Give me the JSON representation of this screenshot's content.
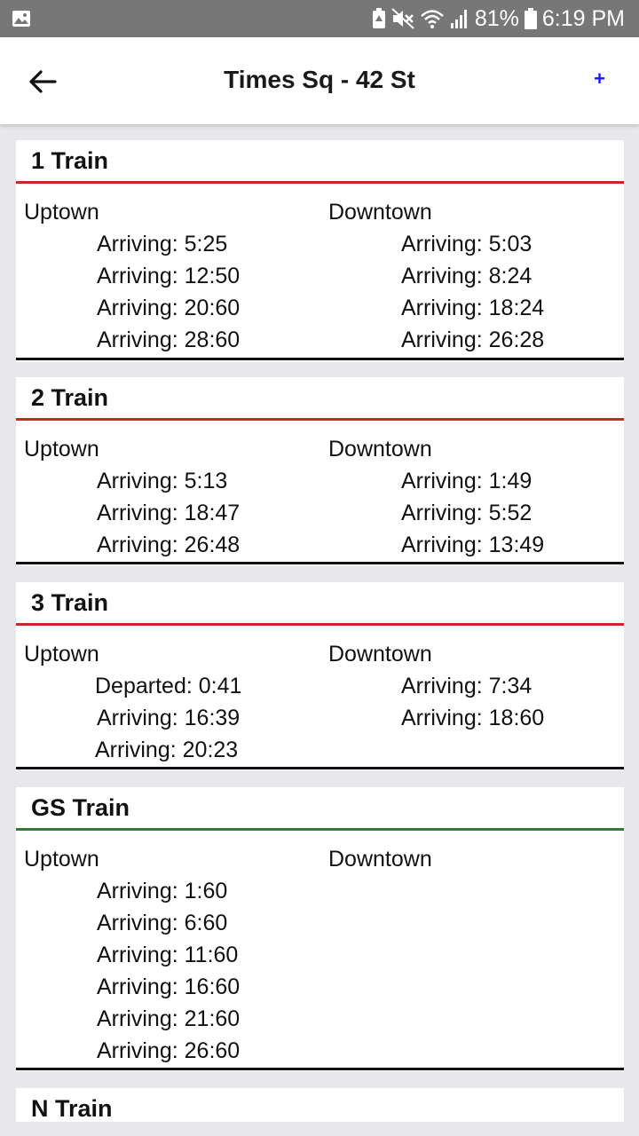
{
  "status_bar": {
    "battery_percent": "81%",
    "time": "6:19 PM",
    "icons": [
      "gallery-icon",
      "battery-saver-icon",
      "mute-icon",
      "wifi-icon",
      "signal-icon",
      "battery-icon"
    ]
  },
  "app_bar": {
    "title": "Times Sq - 42 St",
    "back_icon": "arrow-left-icon",
    "add_label": "+"
  },
  "colors": {
    "red_line": "#c62828",
    "green_line": "#2e7d32"
  },
  "trains": [
    {
      "name": "1 Train",
      "line_color": "#c62828",
      "uptown_label": "Uptown",
      "downtown_label": "Downtown",
      "uptown": [
        "Arriving: 5:25",
        "Arriving: 12:50",
        "Arriving: 20:60",
        "Arriving: 28:60"
      ],
      "downtown": [
        "Arriving: 5:03",
        "Arriving: 8:24",
        "Arriving: 18:24",
        "Arriving: 26:28"
      ]
    },
    {
      "name": "2 Train",
      "line_color": "#c62828",
      "uptown_label": "Uptown",
      "downtown_label": "Downtown",
      "uptown": [
        "Arriving: 5:13",
        "Arriving: 18:47",
        "Arriving: 26:48"
      ],
      "downtown": [
        "Arriving: 1:49",
        "Arriving: 5:52",
        "Arriving: 13:49"
      ]
    },
    {
      "name": "3 Train",
      "line_color": "#c62828",
      "uptown_label": "Uptown",
      "downtown_label": "Downtown",
      "uptown": [
        "Departed: 0:41",
        "Arriving: 16:39",
        "Arriving: 20:23"
      ],
      "downtown": [
        "Arriving: 7:34",
        "Arriving: 18:60"
      ]
    },
    {
      "name": "GS Train",
      "line_color": "#2e7d32",
      "uptown_label": "Uptown",
      "downtown_label": "Downtown",
      "uptown": [
        "Arriving: 1:60",
        "Arriving: 6:60",
        "Arriving: 11:60",
        "Arriving: 16:60",
        "Arriving: 21:60",
        "Arriving: 26:60"
      ],
      "downtown": []
    },
    {
      "name": "N Train",
      "line_color": "#f9a825",
      "uptown_label": "",
      "downtown_label": "",
      "uptown": [],
      "downtown": []
    }
  ]
}
